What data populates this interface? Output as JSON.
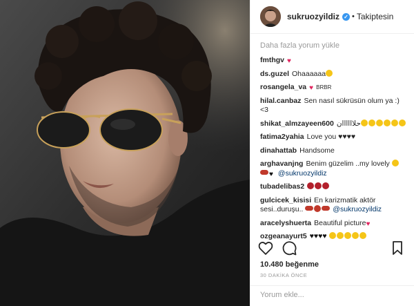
{
  "post": {
    "username": "sukruozyildiz",
    "separator": "•",
    "follow_status": "Takiptesin",
    "load_more": "Daha fazla yorum yükle",
    "likes": "10.480 beğenme",
    "time": "30 DAKİKA ÖNCE",
    "comment_placeholder": "Yorum ekle..."
  },
  "comments": [
    {
      "user": "fmthgv",
      "text": "",
      "emoji_after": [
        "heart"
      ]
    },
    {
      "user": "ds.guzel",
      "text": "Ohaaaaaa",
      "emoji_after": [
        "yellow"
      ]
    },
    {
      "user": "rosangela_va",
      "text": "BRBR",
      "emoji_before_text": [
        "heart"
      ]
    },
    {
      "user": "hilal.canbaz",
      "text": "Sen nasıl sükrüsün olum ya :) <3"
    },
    {
      "user": "shikat_almzayeen600",
      "text": "حلاااااان",
      "emoji_after": [
        "yellow",
        "yellow",
        "yellow",
        "yellow",
        "yellow",
        "yellow"
      ]
    },
    {
      "user": "fatima2yahia",
      "text": "Love you ♥♥♥♥"
    },
    {
      "user": "dinahattab",
      "text": "Handsome"
    },
    {
      "user": "arghavanjng",
      "text": "Benim güzelim ..my lovely",
      "emoji_after": [
        "yellow"
      ],
      "line2_emoji": [
        "lips",
        "heart"
      ],
      "mention": "@sukruozyildiz"
    },
    {
      "user": "tubadelibas2",
      "text": "",
      "emoji_after": [
        "rose",
        "rose",
        "rose"
      ]
    },
    {
      "user": "gulcicek_kisisi",
      "text": "En karizmatik aktör sesi..duruşu..",
      "emoji_after": [
        "lips",
        "red",
        "lips"
      ],
      "mention": "@sukruozyildiz"
    },
    {
      "user": "aracelyshuerta",
      "text": "Beautiful picture",
      "emoji_after": [
        "heart"
      ]
    },
    {
      "user": "ozgeanayurt5",
      "text": "♥♥♥♥",
      "emoji_after": [
        "yellow",
        "yellow",
        "yellow",
        "yellow",
        "yellow"
      ]
    }
  ],
  "icons": {
    "like": "heart-outline-icon",
    "comment": "speech-bubble-icon",
    "save": "bookmark-icon",
    "verified": "verified-badge-icon"
  },
  "colors": {
    "link": "#003569",
    "muted": "#999999",
    "verified": "#3897f0",
    "heart": "#e0245e"
  }
}
